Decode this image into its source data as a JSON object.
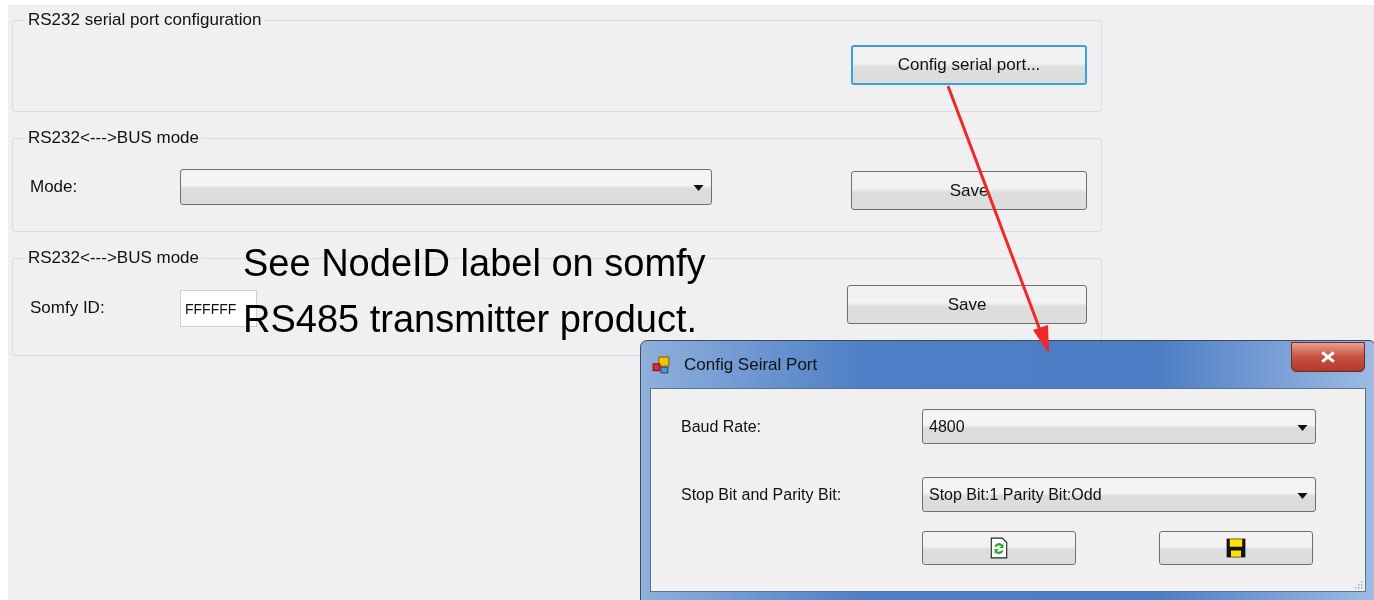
{
  "serial_port_group": {
    "title": "RS232 serial port configuration",
    "button": {
      "label": "Config serial port...",
      "focused": true
    }
  },
  "bus_mode_group": {
    "title": "RS232<--->BUS mode",
    "mode_label": "Mode:",
    "save_button": "Save"
  },
  "somfy_group": {
    "title": "RS232<--->BUS mode",
    "id_label": "Somfy ID:",
    "id_value": "FFFFFF",
    "save_button": "Save"
  },
  "annotation": {
    "lines": [
      "See NodeID label on somfy",
      "RS485 transmitter product."
    ]
  },
  "dialog": {
    "title": "Config Seiral Port",
    "fields": [
      {
        "label": "Baud Rate:",
        "value": "4800"
      },
      {
        "label": "Stop Bit and Parity Bit:",
        "value": "Stop Bit:1 Parity Bit:Odd"
      }
    ],
    "buttons": [
      {
        "kind": "refresh"
      },
      {
        "kind": "save"
      }
    ]
  }
}
